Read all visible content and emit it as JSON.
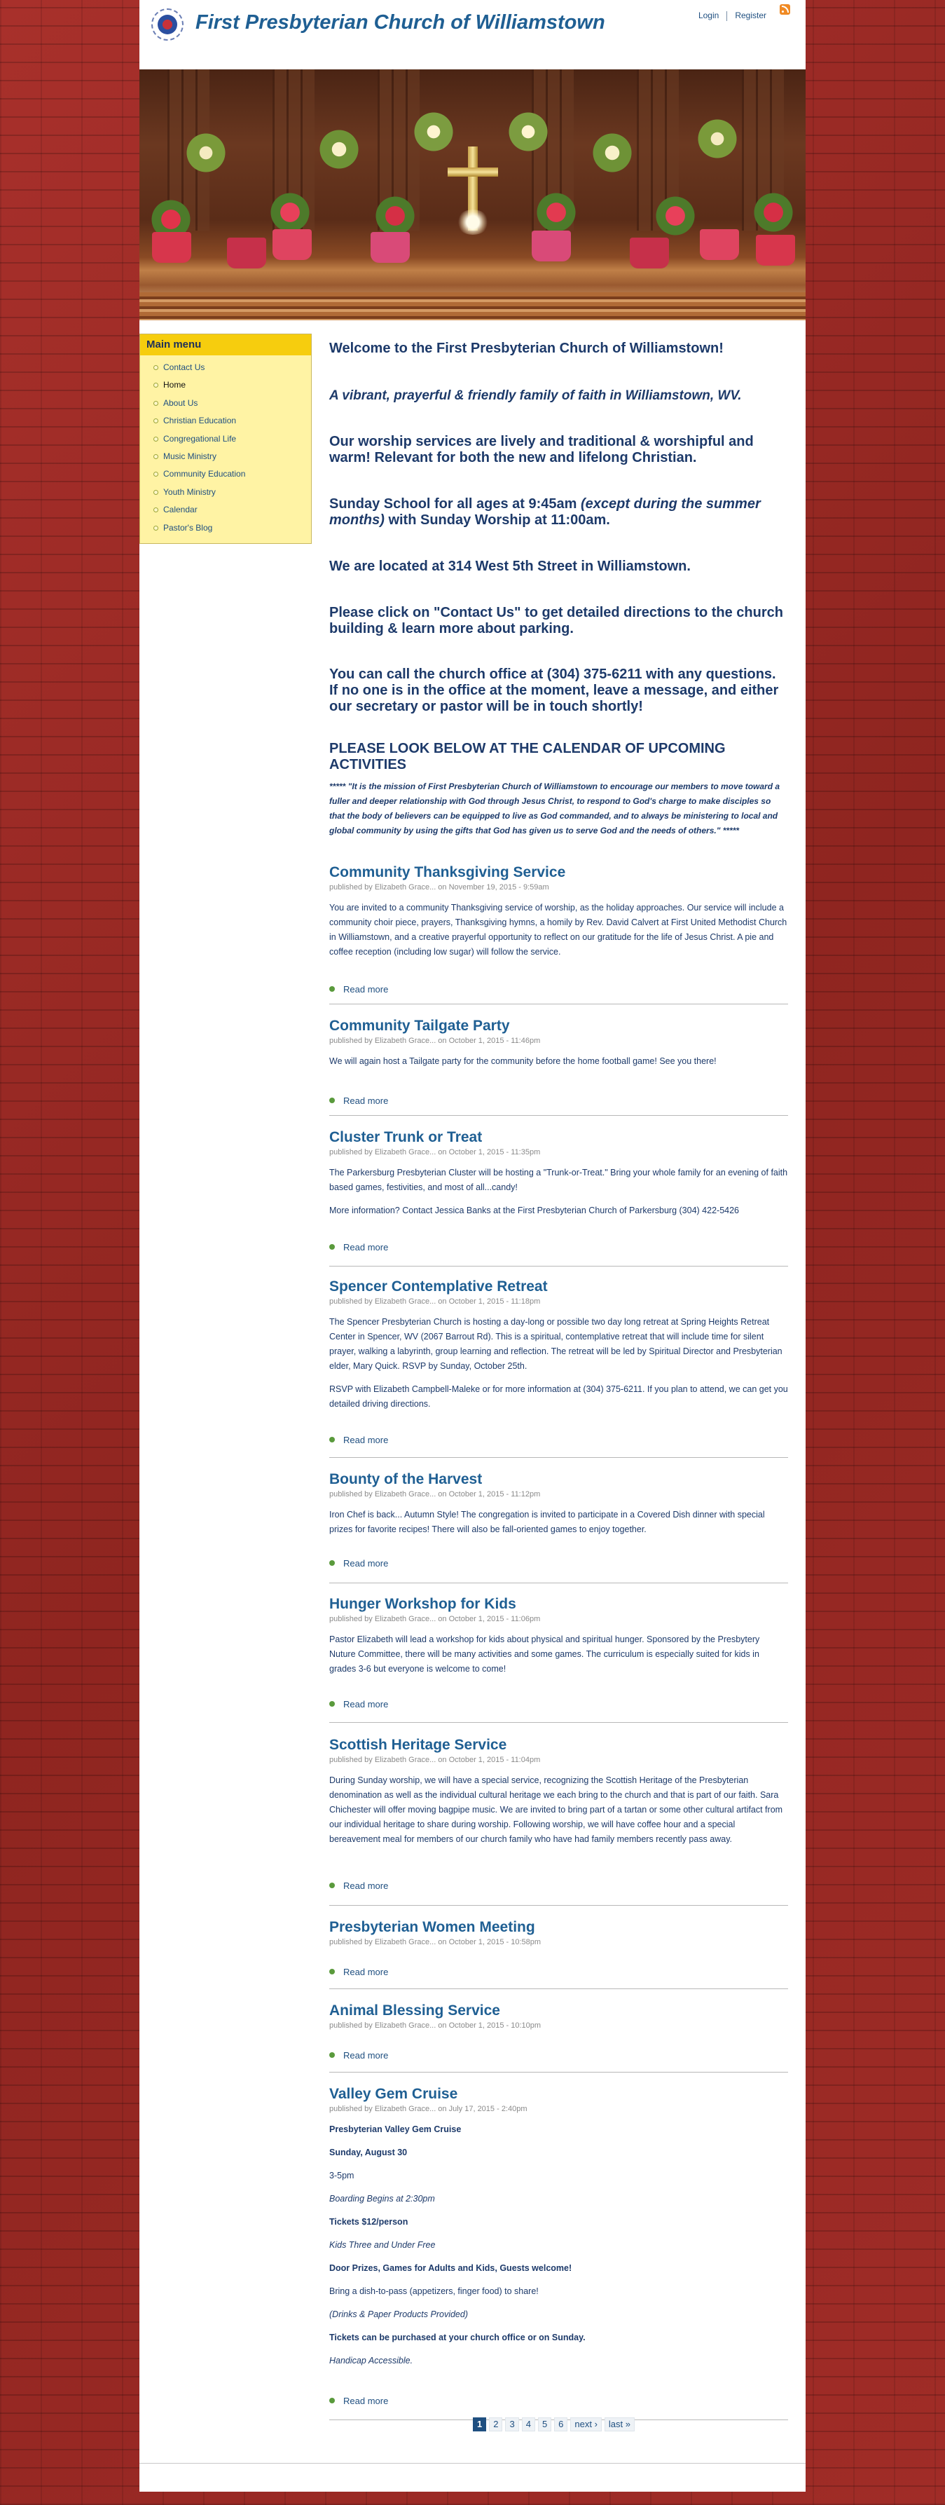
{
  "site": {
    "name": "First Presbyterian Church of Williamstown",
    "login": "Login",
    "register": "Register"
  },
  "sidebar": {
    "title": "Main menu",
    "items": [
      "Contact Us",
      "Home",
      "About Us",
      "Christian Education",
      "Congregational Life",
      "Music Ministry",
      "Community Education",
      "Youth Ministry",
      "Calendar",
      "Pastor's Blog"
    ],
    "active": "Home"
  },
  "intro": {
    "welcome": "Welcome to the First Presbyterian Church of Williamstown!",
    "tagline": "A vibrant, prayerful & friendly family of faith in Williamstown, WV.",
    "worship": "Our worship services are lively and traditional & worshipful and warm! Relevant for both the new and lifelong Christian.",
    "sunday_a": "Sunday School for all ages at 9:45am ",
    "sunday_b": "(except during the summer months)",
    "sunday_c": " with Sunday Worship at 11:00am.",
    "location": "We are located at 314 West 5th Street in Williamstown.",
    "contact": "Please click on \"Contact Us\" to get detailed directions to the church building & learn more about parking.",
    "call": "You can call the church office at (304) 375-6211 with any questions.  If no one is in the office at the moment, leave a message, and either our secretary or pastor will be in touch shortly!",
    "calendar": "PLEASE LOOK BELOW AT THE CALENDAR OF UPCOMING ACTIVITIES",
    "mission": "*****  \"It is the mission of First Presbyterian Church of Williamstown to encourage our members to move toward a fuller and deeper relationship with God through Jesus Christ, to respond to God's charge to make disciples so that the body of believers can be equipped to live as God commanded, and to always be ministering to local and global community by using the gifts that God has given us to serve God and the needs of others.\"  *****"
  },
  "read_more": "Read more",
  "posts": [
    {
      "title": "Community Thanksgiving Service",
      "meta": "published by Elizabeth Grace... on November 19, 2015 - 9:59am",
      "body": [
        "You are invited to a community Thanksgiving service of worship, as the holiday approaches.  Our service will include a community choir piece, prayers, Thanksgiving hymns, a homily by Rev. David Calvert at First United Methodist Church in Williamstown, and a creative prayerful opportunity to reflect on our gratitude for the life of Jesus Christ.  A pie and coffee reception (including low sugar) will follow the service."
      ]
    },
    {
      "title": "Community Tailgate Party",
      "meta": "published by Elizabeth Grace... on October 1, 2015 - 11:46pm",
      "body": [
        "We will again host a Tailgate party for the community before the home football game!  See you there!"
      ]
    },
    {
      "title": "Cluster Trunk or Treat",
      "meta": "published by Elizabeth Grace... on October 1, 2015 - 11:35pm",
      "body": [
        "The Parkersburg Presbyterian Cluster will be hosting a \"Trunk-or-Treat.\" Bring your whole family for an evening of faith based games, festivities, and most of all...candy!",
        "More information? Contact Jessica Banks at the First Presbyterian Church of Parkersburg        (304) 422-5426"
      ]
    },
    {
      "title": "Spencer Contemplative Retreat",
      "meta": "published by Elizabeth Grace... on October 1, 2015 - 11:18pm",
      "body": [
        "The Spencer Presbyterian Church is hosting a day-long or possible two day long retreat at Spring Heights Retreat Center in Spencer, WV (2067 Barrout Rd). This is a spiritual, contemplative retreat that will include time for silent prayer, walking a labyrinth, group learning and reflection. The retreat will be led by Spiritual Director and Presbyterian elder, Mary Quick. RSVP by Sunday, October 25th.",
        "RSVP with Elizabeth Campbell-Maleke or for more information at (304) 375-6211.  If you plan to attend, we can get you detailed driving directions."
      ]
    },
    {
      "title": "Bounty of the Harvest",
      "meta": "published by Elizabeth Grace... on October 1, 2015 - 11:12pm",
      "body": [
        "Iron Chef is back... Autumn Style!  The congregation is invited to participate in a Covered Dish dinner with special prizes for favorite recipes!  There will also be fall-oriented games to enjoy together."
      ]
    },
    {
      "title": "Hunger Workshop for Kids",
      "meta": "published by Elizabeth Grace... on October 1, 2015 - 11:06pm",
      "body": [
        "Pastor Elizabeth will lead a workshop for kids about physical and spiritual hunger.  Sponsored by the Presbytery Nuture Committee, there will be many activities and some games.  The curriculum is especially suited for kids in grades 3-6 but everyone is welcome to come!"
      ]
    },
    {
      "title": "Scottish Heritage Service",
      "meta": "published by Elizabeth Grace... on October 1, 2015 - 11:04pm",
      "body": [
        "During Sunday worship, we will have a special service, recognizing the Scottish Heritage of the Presbyterian denomination as well as the individual cultural heritage we each bring to the church and that is part of our faith.  Sara Chichester will offer moving bagpipe music.  We are invited to bring part of a tartan or some other cultural artifact from our individual heritage to share during worship.  Following worship, we will have coffee hour and a special bereavement meal for members of our church family who have had family members recently pass away."
      ]
    },
    {
      "title": "Presbyterian Women Meeting",
      "meta": "published by Elizabeth Grace... on October 1, 2015 - 10:58pm",
      "body": []
    },
    {
      "title": "Animal Blessing Service",
      "meta": "published by Elizabeth Grace... on October 1, 2015 - 10:10pm",
      "body": []
    },
    {
      "title": "Valley Gem Cruise",
      "meta": "published by Elizabeth Grace... on July 17, 2015 - 2:40pm",
      "body": []
    }
  ],
  "cruise_lines": [
    "Presbyterian Valley Gem Cruise",
    "Sunday, August 30",
    "3-5pm",
    "Boarding Begins at 2:30pm",
    "Tickets $12/person",
    "Kids Three and Under Free",
    "Door Prizes, Games for Adults and Kids, Guests welcome!",
    "Bring a dish-to-pass (appetizers, finger food) to share!",
    "(Drinks & Paper Products Provided)",
    "Tickets can be purchased at your church office or on Sunday.",
    "Handicap Accessible."
  ],
  "pager": [
    "1",
    "2",
    "3",
    "4",
    "5",
    "6",
    "next ›",
    "last »"
  ],
  "colors": {
    "accent": "#1f5f93",
    "sidebar_bg": "#fff3a4",
    "sidebar_header": "#f6cd0e",
    "background_brick": "#9b2a26"
  }
}
